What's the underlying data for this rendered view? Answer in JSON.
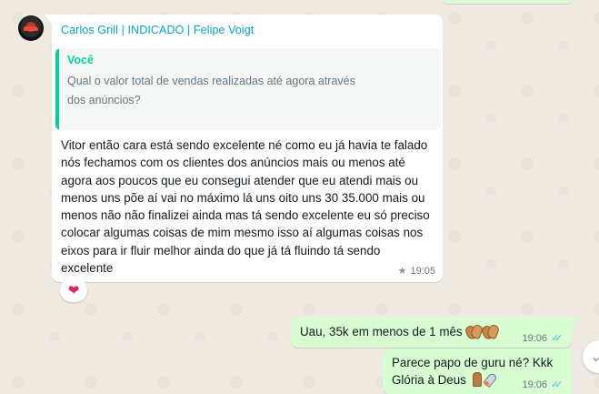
{
  "incoming": {
    "sender": "Carlos Grill | INDICADO | Felipe Voigt",
    "quote": {
      "author": "Você",
      "text": "Qual o valor total de vendas realizadas até agora através dos anúncios?",
      "ellipsis": "..."
    },
    "text": "Vitor então cara está sendo excelente né como eu já havia te falado nós fechamos com os clientes dos anúncios mais ou menos até agora aos poucos que eu consegui atender que eu atendi mais ou menos uns põe aí vai no máximo lá uns oito uns 30 35.000 mais ou menos não não finalizei ainda mas tá sendo excelente eu só preciso colocar algumas coisas de mim mesmo isso aí algumas coisas nos eixos para ir fluir melhor ainda do que já tá fluindo tá sendo excelente",
    "time": "19:05",
    "starred": true,
    "reaction": "❤"
  },
  "outgoing": [
    {
      "text": "Uau, 35k em menos de 1 mês",
      "emojis": [
        "clapping-hands",
        "clapping-hands"
      ],
      "time": "19:06",
      "status": "read"
    },
    {
      "line1": "Parece papo de guru né? Kkk",
      "line2": "Glória à Deus",
      "emojis": [
        "folded-hands",
        "rocket"
      ],
      "time": "19:06",
      "status": "read"
    }
  ],
  "colors": {
    "background": "#efeae2",
    "incoming_bubble": "#ffffff",
    "outgoing_bubble": "#d9fdd3",
    "sender_name": "#06a4c4",
    "quote_accent": "#06cf9c",
    "read_ticks": "#53bdeb"
  }
}
